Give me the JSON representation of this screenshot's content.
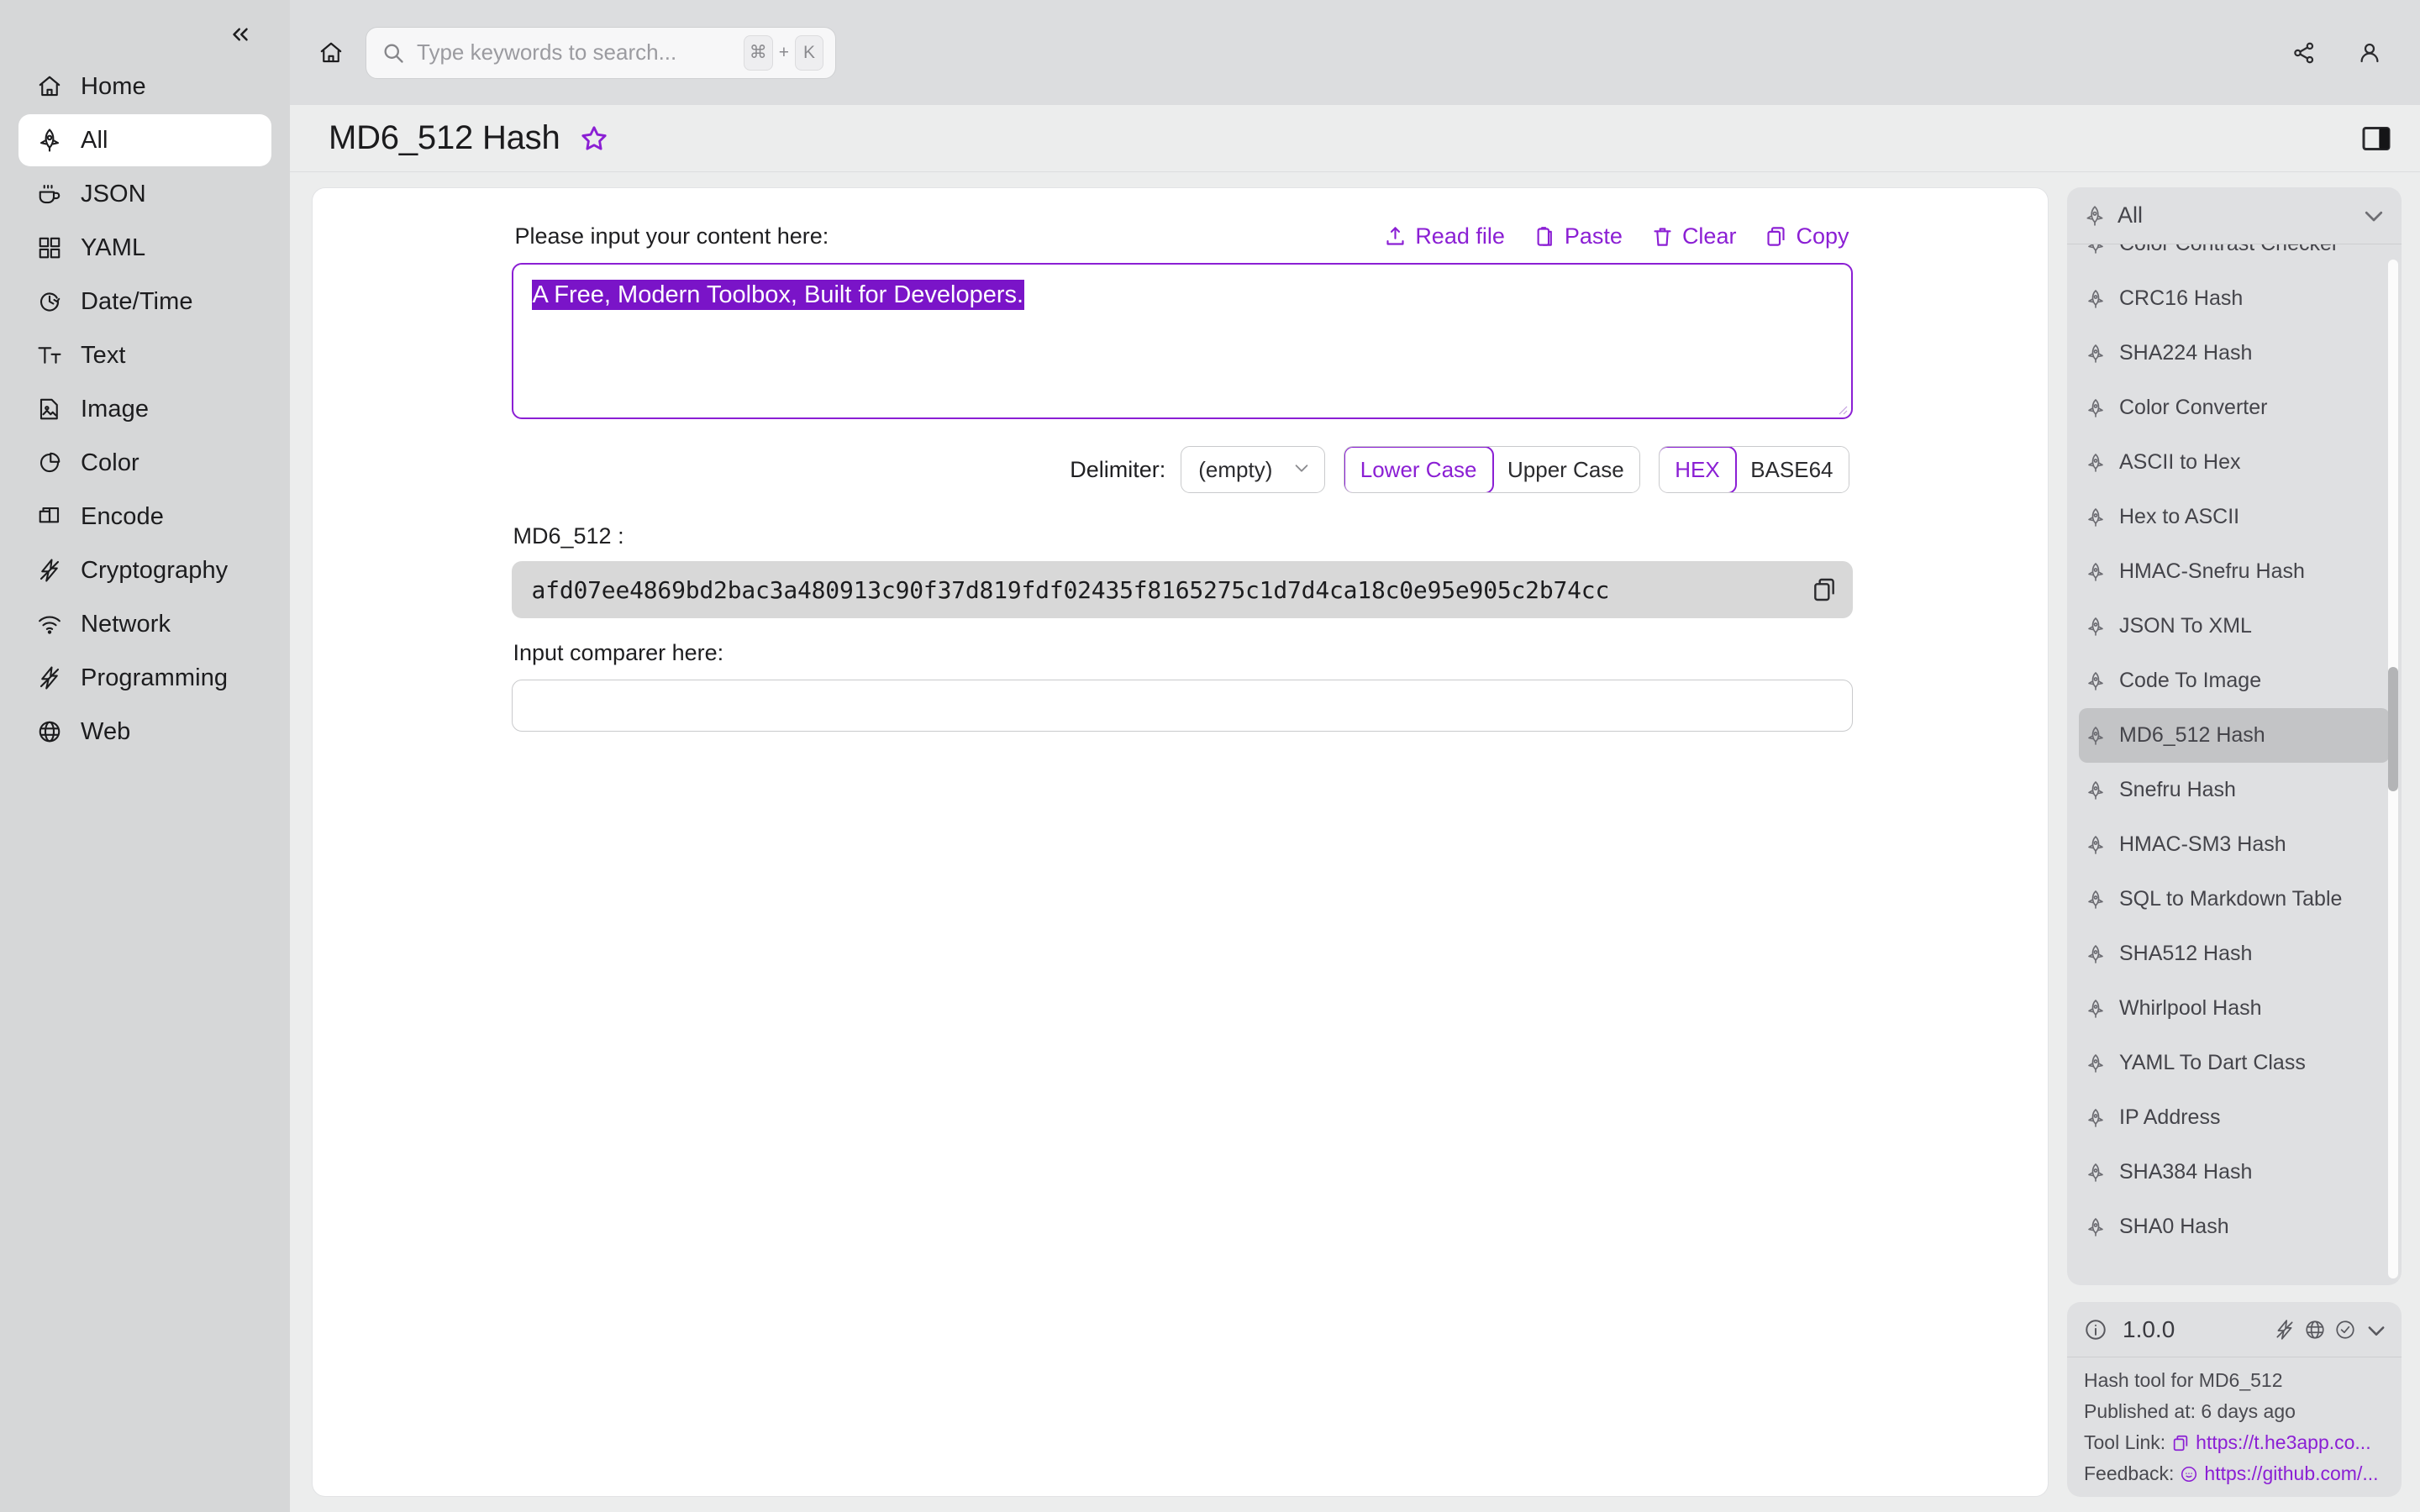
{
  "left_sidebar": {
    "collapse_icon": "chevrons-left-icon",
    "items": [
      {
        "label": "Home",
        "icon": "home-icon",
        "active": false
      },
      {
        "label": "All",
        "icon": "rocket-icon",
        "active": true
      },
      {
        "label": "JSON",
        "icon": "coffee-icon",
        "active": false
      },
      {
        "label": "YAML",
        "icon": "grid-icon",
        "active": false
      },
      {
        "label": "Date/Time",
        "icon": "clock-icon",
        "active": false
      },
      {
        "label": "Text",
        "icon": "text-size-icon",
        "active": false
      },
      {
        "label": "Image",
        "icon": "image-icon",
        "active": false
      },
      {
        "label": "Color",
        "icon": "pie-chart-icon",
        "active": false
      },
      {
        "label": "Encode",
        "icon": "layers-icon",
        "active": false
      },
      {
        "label": "Cryptography",
        "icon": "bolt-icon",
        "active": false
      },
      {
        "label": "Network",
        "icon": "wifi-icon",
        "active": false
      },
      {
        "label": "Programming",
        "icon": "bolt-icon",
        "active": false
      },
      {
        "label": "Web",
        "icon": "globe-icon",
        "active": false
      }
    ]
  },
  "top_bar": {
    "home_icon": "home-icon",
    "search": {
      "icon": "search-icon",
      "value": "",
      "placeholder": "Type keywords to search...",
      "shortcut_key1": "⌘",
      "shortcut_plus": "+",
      "shortcut_key2": "K"
    },
    "share_icon": "share-icon",
    "account_icon": "user-icon"
  },
  "page": {
    "title": "MD6_512 Hash",
    "favorite_icon": "star-outline-icon",
    "panel_toggle_icon": "panel-right-icon"
  },
  "tool": {
    "input_label": "Please input your content here:",
    "actions": [
      {
        "label": "Read file",
        "icon": "upload-icon"
      },
      {
        "label": "Paste",
        "icon": "clipboard-icon"
      },
      {
        "label": "Clear",
        "icon": "trash-icon"
      },
      {
        "label": "Copy",
        "icon": "copy-icon"
      }
    ],
    "input_value": "A Free, Modern Toolbox, Built for Developers.",
    "input_selected": true,
    "delimiter_label": "Delimiter:",
    "delimiter_value": "(empty)",
    "delimiter_chevron_icon": "chevron-down-icon",
    "case_options": [
      {
        "label": "Lower Case",
        "active": true
      },
      {
        "label": "Upper Case",
        "active": false
      }
    ],
    "encoding_options": [
      {
        "label": "HEX",
        "active": true
      },
      {
        "label": "BASE64",
        "active": false
      }
    ],
    "result_label": "MD6_512 :",
    "result_value": "afd07ee4869bd2bac3a480913c90f37d819fdf02435f8165275c1d7d4ca18c0e95e905c2b74cc",
    "result_copy_icon": "copy-icon",
    "comparer_label": "Input comparer here:",
    "comparer_value": ""
  },
  "right_panel": {
    "list_header": {
      "icon": "rocket-icon",
      "title": "All",
      "chevron_icon": "chevron-down-icon"
    },
    "tools": [
      {
        "label": "Color Contrast Checker",
        "selected": false,
        "clipped": true
      },
      {
        "label": "CRC16 Hash",
        "selected": false
      },
      {
        "label": "SHA224 Hash",
        "selected": false
      },
      {
        "label": "Color Converter",
        "selected": false
      },
      {
        "label": "ASCII to Hex",
        "selected": false
      },
      {
        "label": "Hex to ASCII",
        "selected": false
      },
      {
        "label": "HMAC-Snefru Hash",
        "selected": false
      },
      {
        "label": "JSON To XML",
        "selected": false
      },
      {
        "label": "Code To Image",
        "selected": false
      },
      {
        "label": "MD6_512 Hash",
        "selected": true
      },
      {
        "label": "Snefru Hash",
        "selected": false
      },
      {
        "label": "HMAC-SM3 Hash",
        "selected": false
      },
      {
        "label": "SQL to Markdown Table",
        "selected": false
      },
      {
        "label": "SHA512 Hash",
        "selected": false
      },
      {
        "label": "Whirlpool Hash",
        "selected": false
      },
      {
        "label": "YAML To Dart Class",
        "selected": false
      },
      {
        "label": "IP Address",
        "selected": false
      },
      {
        "label": "SHA384 Hash",
        "selected": false
      },
      {
        "label": "SHA0 Hash",
        "selected": false
      }
    ],
    "info": {
      "info_icon": "info-circle-icon",
      "version": "1.0.0",
      "header_icons": [
        "bolt-icon",
        "globe-icon",
        "check-circle-icon",
        "chevron-down-icon"
      ],
      "description": "Hash tool for MD6_512",
      "published": "Published at: 6 days ago",
      "tool_link_label": "Tool Link:",
      "tool_link_icon": "copy-icon",
      "tool_link_url": "https://t.he3app.co...",
      "feedback_label": "Feedback:",
      "feedback_icon": "message-icon",
      "feedback_url": "https://github.com/..."
    }
  },
  "colors": {
    "accent": "#8b1fd4",
    "selection": "#7a14c8",
    "sidebar_bg": "#d6d7d8",
    "topbar_bg": "#dcdddf",
    "page_bg": "#eceded",
    "card_bg": "#ffffff",
    "result_bg": "#d8d8d8",
    "panel_bg": "#dfe0e2"
  }
}
